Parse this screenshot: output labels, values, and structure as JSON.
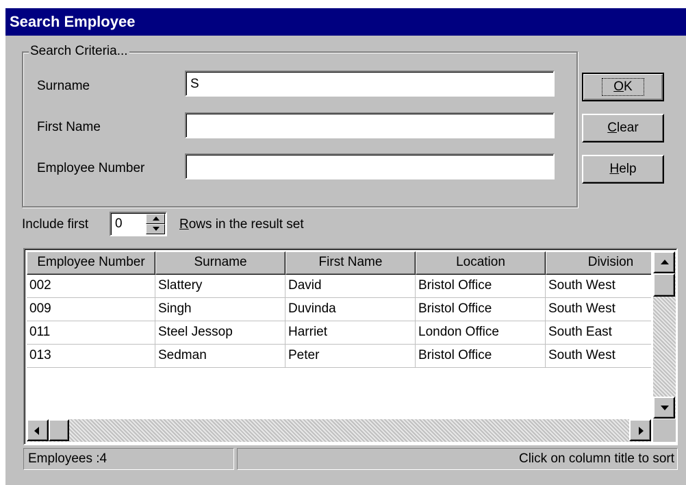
{
  "window": {
    "title": "Search Employee"
  },
  "criteria": {
    "legend": "Search Criteria...",
    "surname": {
      "label": "Surname",
      "value": "S"
    },
    "first_name": {
      "label": "First Name",
      "value": ""
    },
    "employee_number": {
      "label": "Employee Number",
      "value": ""
    }
  },
  "buttons": {
    "ok": {
      "mnemonic": "O",
      "rest": "K"
    },
    "clear": {
      "mnemonic": "C",
      "rest": "lear"
    },
    "help": {
      "mnemonic": "H",
      "rest": "elp"
    }
  },
  "include": {
    "prefix": "Include first",
    "value": "0",
    "suffix_mnemonic": "R",
    "suffix_rest": "ows in the result set"
  },
  "grid": {
    "columns": [
      "Employee Number",
      "Surname",
      "First Name",
      "Location",
      "Division"
    ],
    "rows": [
      [
        "002",
        "Slattery",
        "David",
        "Bristol Office",
        "South West"
      ],
      [
        "009",
        "Singh",
        "Duvinda",
        "Bristol Office",
        "South West"
      ],
      [
        "011",
        "Steel Jessop",
        "Harriet",
        "London Office",
        "South East"
      ],
      [
        "013",
        "Sedman",
        "Peter",
        "Bristol Office",
        "South West"
      ]
    ]
  },
  "status": {
    "count_text": "Employees :4",
    "hint_text": "Click on column title to sort"
  }
}
